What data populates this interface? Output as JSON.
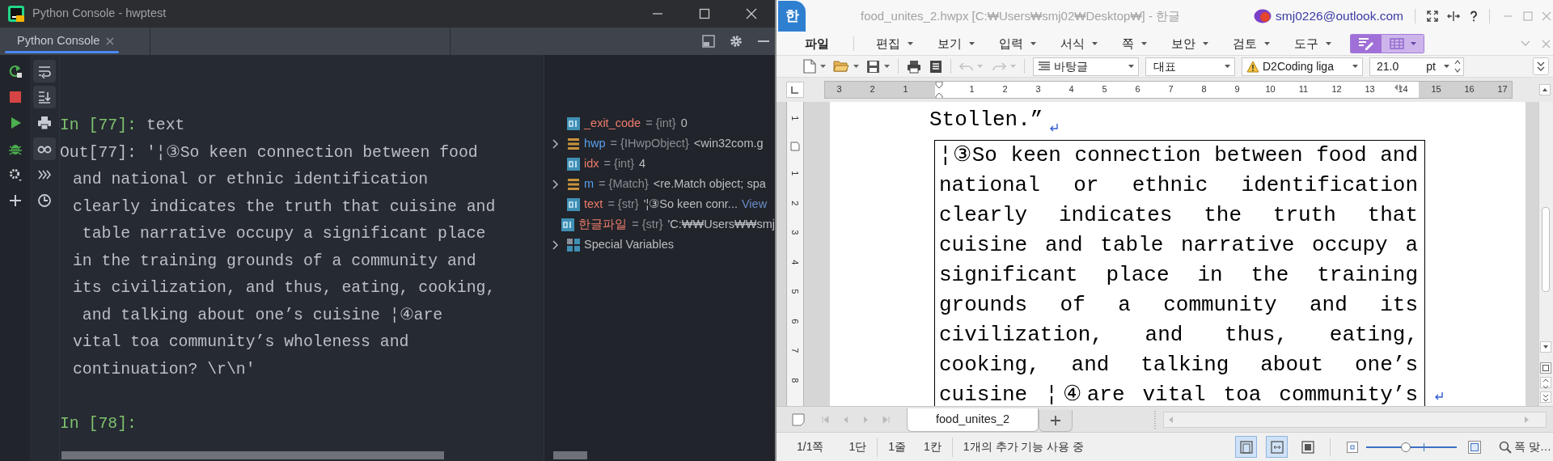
{
  "console_window": {
    "title": "Python Console - hwptest",
    "tab": {
      "label": "Python Console",
      "selected": true
    },
    "console": [
      {
        "kind": "input",
        "prompt": "In [77]:",
        "text": "text"
      },
      {
        "kind": "output",
        "prompt": "Out[77]:",
        "text": "'¦③So keen connection between food"
      },
      {
        "kind": "continuation",
        "text": "and national or ethnic identification"
      },
      {
        "kind": "continuation",
        "text": "clearly indicates the truth that cuisine and"
      },
      {
        "kind": "continuation",
        "text": " table narrative occupy a significant place"
      },
      {
        "kind": "continuation",
        "text": "in the training grounds of a community and"
      },
      {
        "kind": "continuation",
        "text": "its civilization, and thus, eating, cooking,"
      },
      {
        "kind": "continuation",
        "text": " and talking about one’s cuisine ¦④are"
      },
      {
        "kind": "continuation",
        "text": "vital toa community’s wholeness and"
      },
      {
        "kind": "continuation",
        "text": "continuation? \\r\\n'"
      },
      {
        "kind": "blank"
      },
      {
        "kind": "input",
        "prompt": "In [78]:"
      }
    ],
    "variables": [
      {
        "kind": "scalar",
        "expandable": false,
        "name": "_exit_code",
        "type": "= {int}",
        "value": "0"
      },
      {
        "kind": "object",
        "expandable": true,
        "name": "hwp",
        "type": "= {IHwpObject}",
        "value": "<win32com.g"
      },
      {
        "kind": "scalar",
        "expandable": false,
        "name": "idx",
        "type": "= {int}",
        "value": "4"
      },
      {
        "kind": "object",
        "expandable": true,
        "name": "m",
        "type": "= {Match}",
        "value": "<re.Match object; spa"
      },
      {
        "kind": "scalar",
        "expandable": false,
        "name": "text",
        "type": "= {str}",
        "value": "'¦③So keen conr...",
        "link": "View"
      },
      {
        "kind": "scalar",
        "expandable": false,
        "name": "한글파일",
        "type": "= {str}",
        "value": "'C:₩₩Users₩₩smj"
      },
      {
        "kind": "group",
        "expandable": true,
        "name": "Special Variables"
      }
    ]
  },
  "hwp_window": {
    "logo": "한",
    "title": "food_unites_2.hwpx [C:₩Users₩smj02₩Desktop₩] - 한글",
    "account": "smj0226@outlook.com",
    "menu": [
      {
        "label": "파일",
        "dropdown": false
      },
      {
        "label": "편집",
        "dropdown": true
      },
      {
        "label": "보기",
        "dropdown": true
      },
      {
        "label": "입력",
        "dropdown": true
      },
      {
        "label": "서식",
        "dropdown": true
      },
      {
        "label": "쪽",
        "dropdown": true
      },
      {
        "label": "보안",
        "dropdown": true
      },
      {
        "label": "검토",
        "dropdown": true
      },
      {
        "label": "도구",
        "dropdown": true
      }
    ],
    "toolbar": {
      "style": "바탕글",
      "outline": "대표",
      "font": "D2Coding liga",
      "size": "21.0",
      "unit": "pt"
    },
    "ruler": [
      "3",
      "2",
      "1",
      "1",
      "2",
      "3",
      "4",
      "5",
      "6",
      "7",
      "8",
      "9",
      "10",
      "11",
      "12",
      "13",
      "14",
      "15",
      "16",
      "17"
    ],
    "vertical_ruler": [
      "1",
      "1",
      "2",
      "3",
      "4",
      "5",
      "6",
      "7",
      "8"
    ],
    "document": {
      "before": [
        {
          "text": "Stollen.”",
          "paragraph_end": true
        }
      ],
      "box_lines": [
        {
          "text": "¦③So keen connection between food and",
          "paragraph_end": false
        },
        {
          "text": "national or ethnic identification",
          "paragraph_end": false
        },
        {
          "text": "clearly indicates the truth that",
          "paragraph_end": false
        },
        {
          "text": "cuisine and table narrative occupy a",
          "paragraph_end": false
        },
        {
          "text": "significant place in the training",
          "paragraph_end": false
        },
        {
          "text": "grounds of a community and its",
          "paragraph_end": false
        },
        {
          "text": "civilization, and thus, eating,",
          "paragraph_end": false
        },
        {
          "text": "cooking, and talking about one’s",
          "paragraph_end": false
        },
        {
          "text": "cuisine ¦④are vital toa community’s",
          "paragraph_end": true
        }
      ]
    },
    "sheet_tabs": [
      {
        "label": "food_unites_2",
        "selected": true
      }
    ],
    "status": [
      {
        "text": "1/1쪽",
        "divider_after": false
      },
      {
        "text": "1단",
        "divider_after": true
      },
      {
        "text": "1줄",
        "divider_after": false
      },
      {
        "text": "1칸",
        "divider_after": true
      },
      {
        "text": "1개의 추가 기능 사용 중",
        "divider_after": false
      }
    ],
    "view_buttons": [
      {
        "selected": true
      },
      {
        "selected": true
      },
      {
        "selected": false
      }
    ],
    "zoom": {
      "level": 0.44,
      "label": "폭 맞…"
    }
  }
}
